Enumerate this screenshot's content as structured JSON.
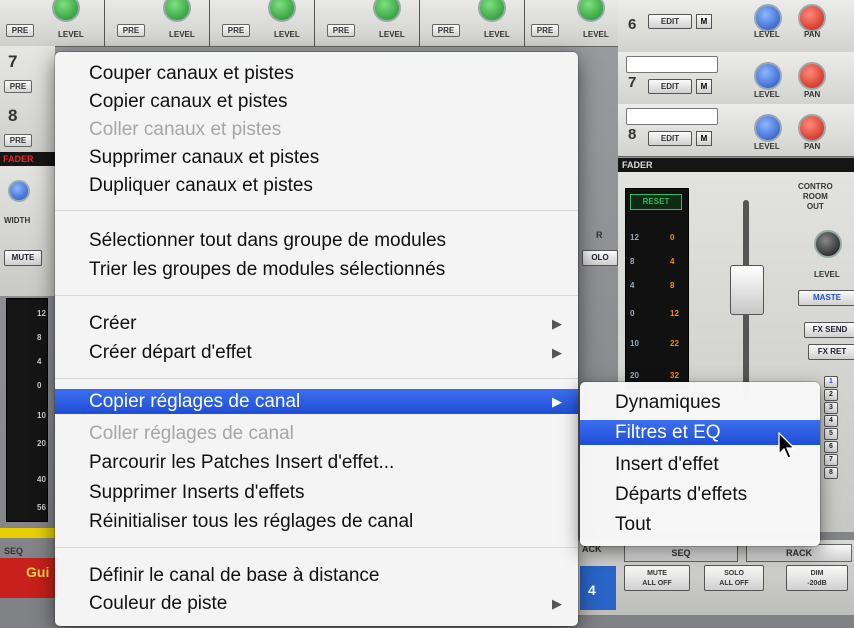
{
  "mixer": {
    "top_strips": [
      {
        "pre": "PRE",
        "level": "LEVEL"
      },
      {
        "pre": "PRE",
        "level": "LEVEL"
      },
      {
        "pre": "PRE",
        "level": "LEVEL"
      },
      {
        "pre": "PRE",
        "level": "LEVEL"
      },
      {
        "pre": "PRE",
        "level": "LEVEL"
      },
      {
        "pre": "PRE",
        "level": "LEVEL"
      }
    ],
    "left_channels": [
      {
        "number": "7",
        "pre": "PRE"
      },
      {
        "number": "8",
        "pre": "PRE"
      }
    ],
    "left_fader_label": "FADER",
    "left_width_label": "WIDTH",
    "left_mute_label": "MUTE",
    "left_meter_ticks": [
      "12",
      "8",
      "4",
      "0",
      "10",
      "20",
      "40",
      "56"
    ],
    "left_seq_label": "SEQ",
    "left_track_name": "Gui",
    "right_channels": [
      {
        "number": "6",
        "edit": "EDIT",
        "m": "M",
        "level": "LEVEL",
        "pan": "PAN"
      },
      {
        "number": "7",
        "edit": "EDIT",
        "m": "M",
        "level": "LEVEL",
        "pan": "PAN"
      },
      {
        "number": "8",
        "edit": "EDIT",
        "m": "M",
        "level": "LEVEL",
        "pan": "PAN"
      }
    ],
    "fader_label": "FADER",
    "reset_label": "RESET",
    "r_label": "R",
    "solo_label": "OLO",
    "meter_ticks_left": [
      "12",
      "8",
      "4",
      "0",
      "10",
      "20"
    ],
    "meter_ticks_right": [
      "0",
      "4",
      "8",
      "12",
      "22",
      "32"
    ],
    "control_room_lines": [
      "CONTRO",
      "ROOM",
      "OUT"
    ],
    "level_label": "LEVEL",
    "master_label": "MASTE",
    "fx_send_label": "FX SEND",
    "fx_ret_label": "FX RET",
    "bus_numbers": [
      "1",
      "2",
      "3",
      "4",
      "5",
      "6",
      "7",
      "8"
    ],
    "bottom": {
      "ack_label": "ACK",
      "seq_label": "SEQ",
      "rack_label": "RACK",
      "number": "4",
      "mute_all_off": [
        "MUTE",
        "ALL OFF"
      ],
      "solo_all_off": [
        "SOLO",
        "ALL OFF"
      ],
      "dim": [
        "DIM",
        "-20dB"
      ]
    }
  },
  "context_menu": {
    "items": [
      {
        "label": "Couper canaux et pistes",
        "disabled": false
      },
      {
        "label": "Copier canaux et pistes",
        "disabled": false
      },
      {
        "label": "Coller canaux et pistes",
        "disabled": true
      },
      {
        "label": "Supprimer canaux et pistes",
        "disabled": false
      },
      {
        "label": "Dupliquer canaux et pistes",
        "disabled": false
      },
      {
        "label": "Sélectionner tout dans groupe de modules",
        "disabled": false
      },
      {
        "label": "Trier les groupes de modules sélectionnés",
        "disabled": false
      },
      {
        "label": "Créer",
        "disabled": false,
        "submenu": true
      },
      {
        "label": "Créer départ d'effet",
        "disabled": false,
        "submenu": true
      },
      {
        "label": "Copier réglages de canal",
        "disabled": false,
        "submenu": true,
        "highlighted": true
      },
      {
        "label": "Coller réglages de canal",
        "disabled": true
      },
      {
        "label": "Parcourir les Patches Insert d'effet...",
        "disabled": false
      },
      {
        "label": "Supprimer Inserts d'effets",
        "disabled": false
      },
      {
        "label": "Réinitialiser tous les réglages de canal",
        "disabled": false
      },
      {
        "label": "Définir le canal de base à distance",
        "disabled": false
      },
      {
        "label": "Couleur de piste",
        "disabled": false,
        "submenu": true
      }
    ],
    "arrow": "▶"
  },
  "submenu": {
    "items": [
      {
        "label": "Dynamiques"
      },
      {
        "label": "Filtres et EQ",
        "highlighted": true
      },
      {
        "label": "Insert d'effet"
      },
      {
        "label": "Départs d'effets"
      },
      {
        "label": "Tout"
      }
    ]
  },
  "colors": {
    "highlight": "#2a5ee8",
    "knob_green": "#1c8d2a",
    "knob_blue": "#1e4fc0",
    "knob_red": "#c61e12"
  }
}
